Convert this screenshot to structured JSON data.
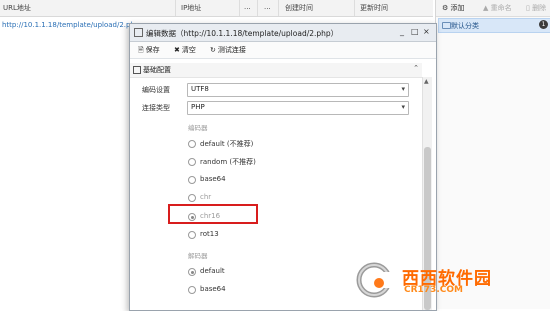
{
  "list": {
    "columns": [
      "URL地址",
      "IP地址",
      "...",
      "...",
      "创建时间",
      "更新时间"
    ],
    "row_url": "http://10.1.1.18/template/upload/2.php"
  },
  "right_panel": {
    "add": "添加",
    "rename": "重命名",
    "delete": "删除",
    "category": "默认分类",
    "count": "1"
  },
  "dialog": {
    "title": "编辑数据（http://10.1.1.18/template/upload/2.php）",
    "controls": [
      "_",
      "□",
      "×"
    ],
    "toolbar": {
      "save": "保存",
      "clear": "清空",
      "test": "测试连接"
    },
    "section": "基础配置",
    "encoding_label": "编码设置",
    "encoding_value": "UTF8",
    "conn_label": "连接类型",
    "conn_value": "PHP",
    "encoder_group": "编码器",
    "encoders": [
      {
        "label": "default (不推荐)",
        "checked": false,
        "faded": false
      },
      {
        "label": "random (不推荐)",
        "checked": false,
        "faded": false
      },
      {
        "label": "base64",
        "checked": false,
        "faded": false
      },
      {
        "label": "chr",
        "checked": false,
        "faded": true
      },
      {
        "label": "chr16",
        "checked": true,
        "faded": true
      },
      {
        "label": "rot13",
        "checked": false,
        "faded": false
      }
    ],
    "decoder_group": "解码器",
    "decoders": [
      {
        "label": "default",
        "checked": true,
        "faded": false
      },
      {
        "label": "base64",
        "checked": false,
        "faded": false
      }
    ]
  },
  "watermark": {
    "text": "西西软件园",
    "url": "CR173.COM"
  }
}
